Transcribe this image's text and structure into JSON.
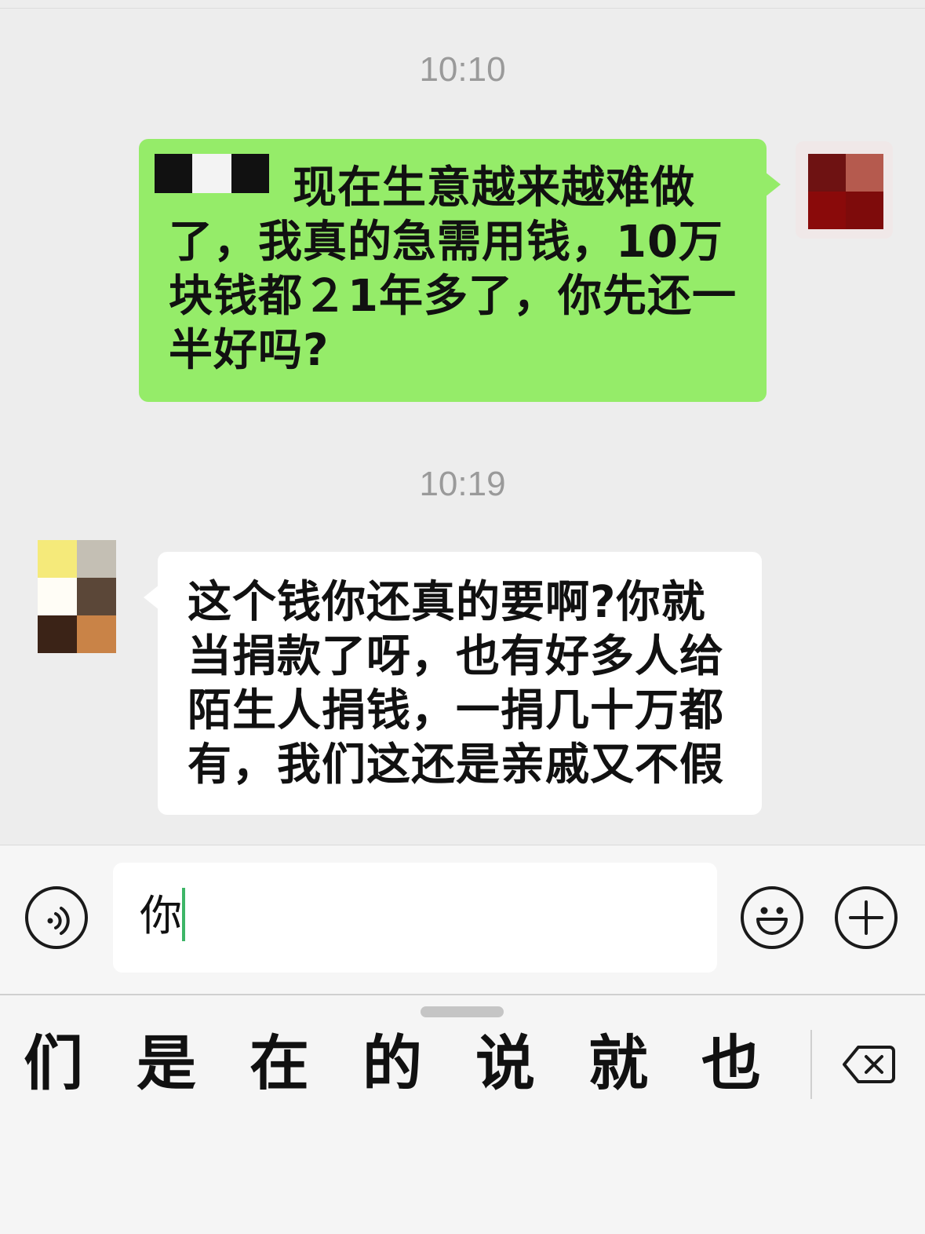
{
  "chat": {
    "timestamps": [
      "10:10",
      "10:19"
    ],
    "outgoing": {
      "lines": [
        "现在生意越来越难做",
        "了，我真的急需用钱，10万",
        "块钱都２1年多了，你先还一",
        "半好吗?"
      ],
      "sender_mosaic_colors": [
        "#111111",
        "#f3f3f3",
        "#111111"
      ]
    },
    "incoming": {
      "lines": [
        "这个钱你还真的要啊?你就",
        "当捐款了呀，也有好多人给",
        "陌生人捐钱，一捐几十万都",
        "有，我们这还是亲戚又不假"
      ]
    },
    "avatars": {
      "me_colors": [
        "#6e1212",
        "#b55a4e",
        "#8a0a0a",
        "#7e0b0b"
      ],
      "other_colors": [
        "#f5ea7a",
        "#c4bfb4",
        "#fffdf6",
        "#5b4738",
        "#3b2317",
        "#c98347"
      ]
    }
  },
  "input": {
    "typed_text": "你",
    "voice_icon": "voice-icon",
    "emoji_icon": "emoji-icon",
    "plus_icon": "plus-icon"
  },
  "keyboard": {
    "candidates": [
      "们",
      "是",
      "在",
      "的",
      "说",
      "就",
      "也"
    ],
    "delete_icon": "delete-icon"
  },
  "colors": {
    "outgoing_bubble": "#95ec69",
    "incoming_bubble": "#ffffff",
    "background": "#ededed",
    "caret": "#3db567"
  }
}
